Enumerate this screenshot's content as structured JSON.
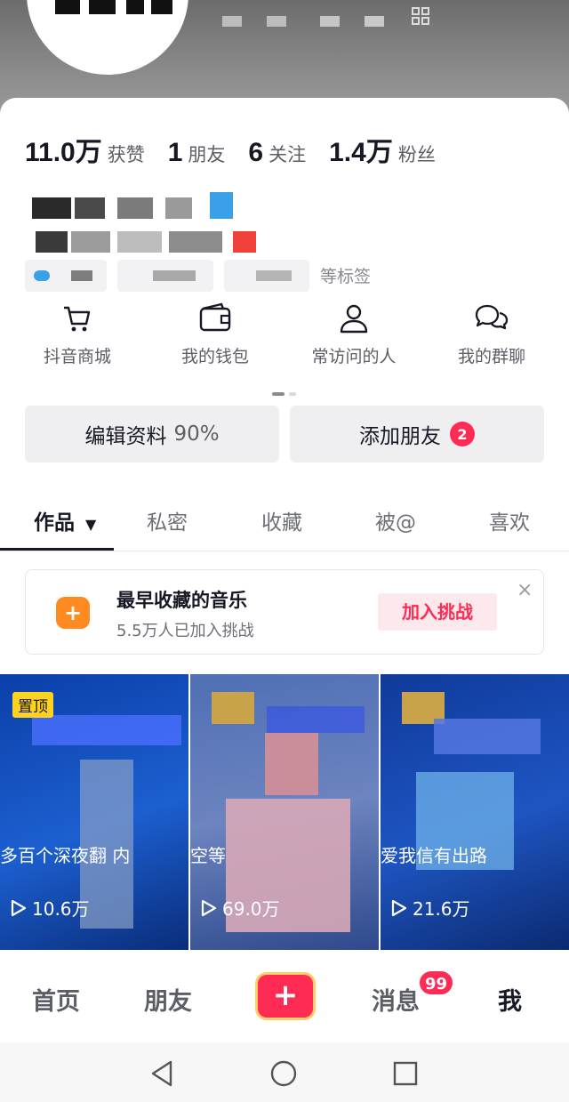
{
  "stats": [
    {
      "num": "11.0万",
      "label": "获赞"
    },
    {
      "num": "1",
      "label": "朋友"
    },
    {
      "num": "6",
      "label": "关注"
    },
    {
      "num": "1.4万",
      "label": "粉丝"
    }
  ],
  "tags": {
    "suffix": "等标签"
  },
  "shortcuts": [
    {
      "label": "抖音商城",
      "icon": "cart-icon"
    },
    {
      "label": "我的钱包",
      "icon": "wallet-icon"
    },
    {
      "label": "常访问的人",
      "icon": "person-icon"
    },
    {
      "label": "我的群聊",
      "icon": "chat-icon"
    }
  ],
  "buttons": {
    "edit_profile": "编辑资料",
    "edit_percent": "90%",
    "add_friend": "添加朋友",
    "add_friend_badge": "2"
  },
  "tabs": [
    "作品",
    "私密",
    "收藏",
    "被@",
    "喜欢"
  ],
  "promo": {
    "title": "最早收藏的音乐",
    "subtitle": "5.5万人已加入挑战",
    "action": "加入挑战",
    "close": "×"
  },
  "videos": [
    {
      "pinned": "置顶",
      "overlay": "多百个深夜翻  内",
      "views": "10.6万"
    },
    {
      "pinned": "",
      "overlay": "      空等",
      "views": "69.0万"
    },
    {
      "pinned": "",
      "overlay": "爱我信有出路",
      "views": "21.6万"
    }
  ],
  "nav": {
    "home": "首页",
    "friends": "朋友",
    "plus": "+",
    "messages": "消息",
    "messages_badge": "99",
    "me": "我"
  },
  "colors": {
    "accent": "#fe2c55",
    "text_primary": "#161823",
    "text_secondary": "#5c5e66",
    "button_bg": "#efeff1",
    "promo_icon": "#ff8a1f"
  }
}
